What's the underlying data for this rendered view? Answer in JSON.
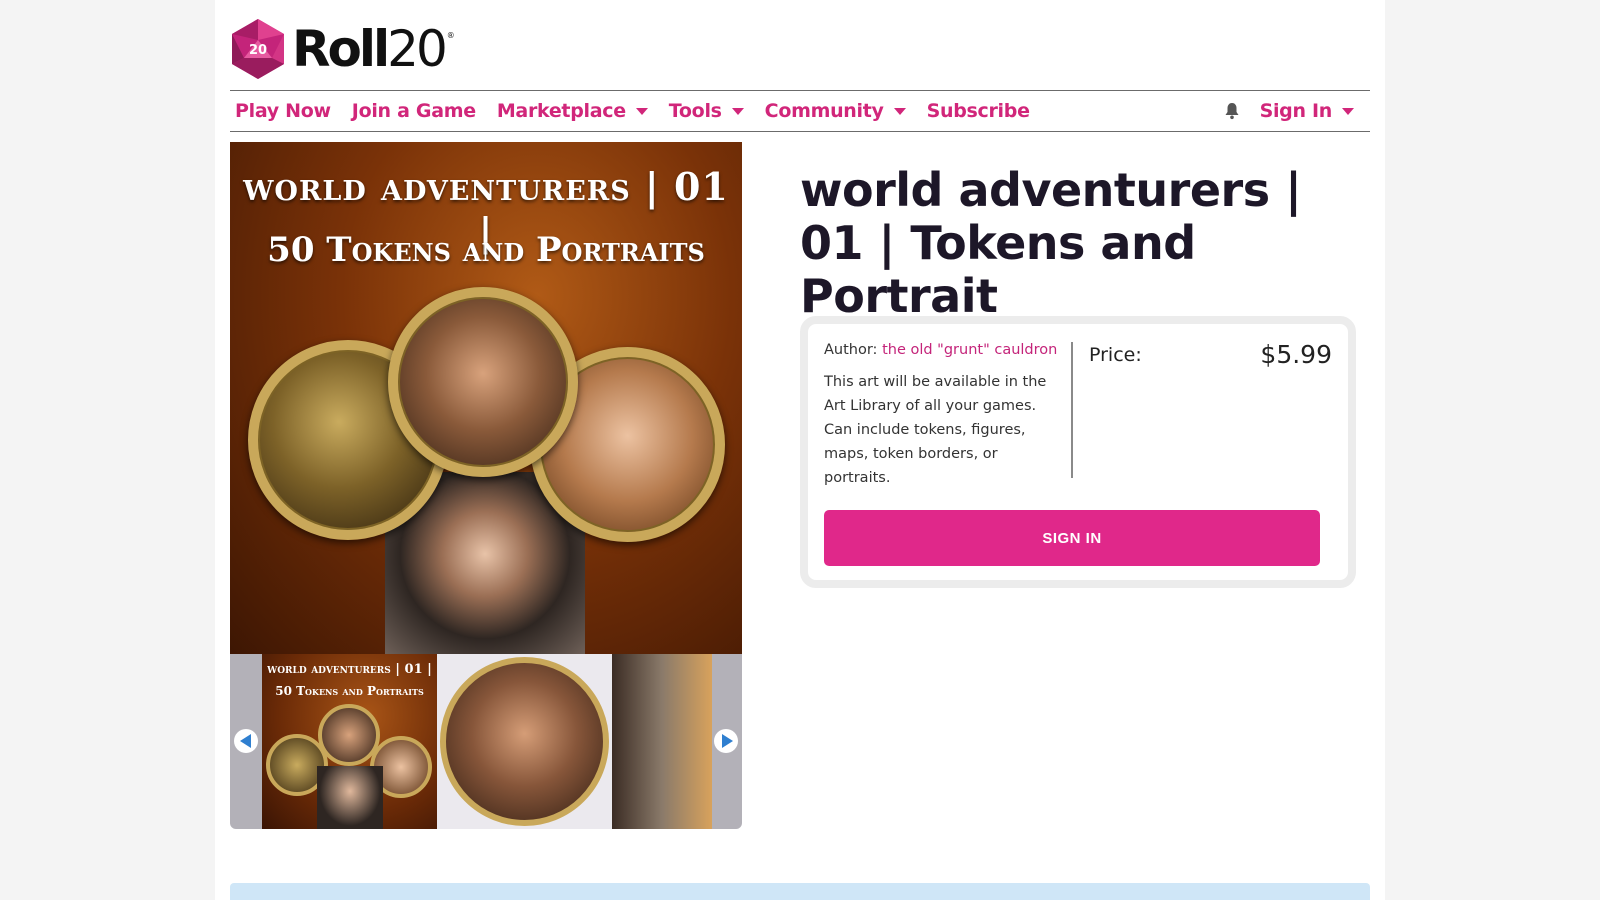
{
  "brand": {
    "name_bold": "Roll",
    "name_thin": "20",
    "die_number": "20",
    "registered": "®",
    "color": "#d1267a"
  },
  "nav": {
    "left": [
      {
        "label": "Play Now",
        "dropdown": false
      },
      {
        "label": "Join a Game",
        "dropdown": false
      },
      {
        "label": "Marketplace",
        "dropdown": true
      },
      {
        "label": "Tools",
        "dropdown": true
      },
      {
        "label": "Community",
        "dropdown": true
      },
      {
        "label": "Subscribe",
        "dropdown": false
      }
    ],
    "bell_icon": "bell-icon",
    "sign_in": "Sign In"
  },
  "gallery": {
    "hero_title_line1": "world adventurers | 01 |",
    "hero_title_line2": "50 Tokens and Portraits",
    "thumb_title_line1": "world adventurers | 01 |",
    "thumb_title_line2": "50 Tokens and Portraits",
    "prev_icon": "arrow-left-icon",
    "next_icon": "arrow-right-icon"
  },
  "product": {
    "title": "world adventurers | 01 | Tokens and Portrait",
    "author_label": "Author:",
    "author_name": "the old \"grunt\" cauldron",
    "description": "This art will be available in the Art Library of all your games. Can include tokens, figures, maps, token borders, or portraits.",
    "price_label": "Price:",
    "price_value": "$5.99",
    "button_label": "SIGN IN",
    "button_color": "#e0288a"
  }
}
